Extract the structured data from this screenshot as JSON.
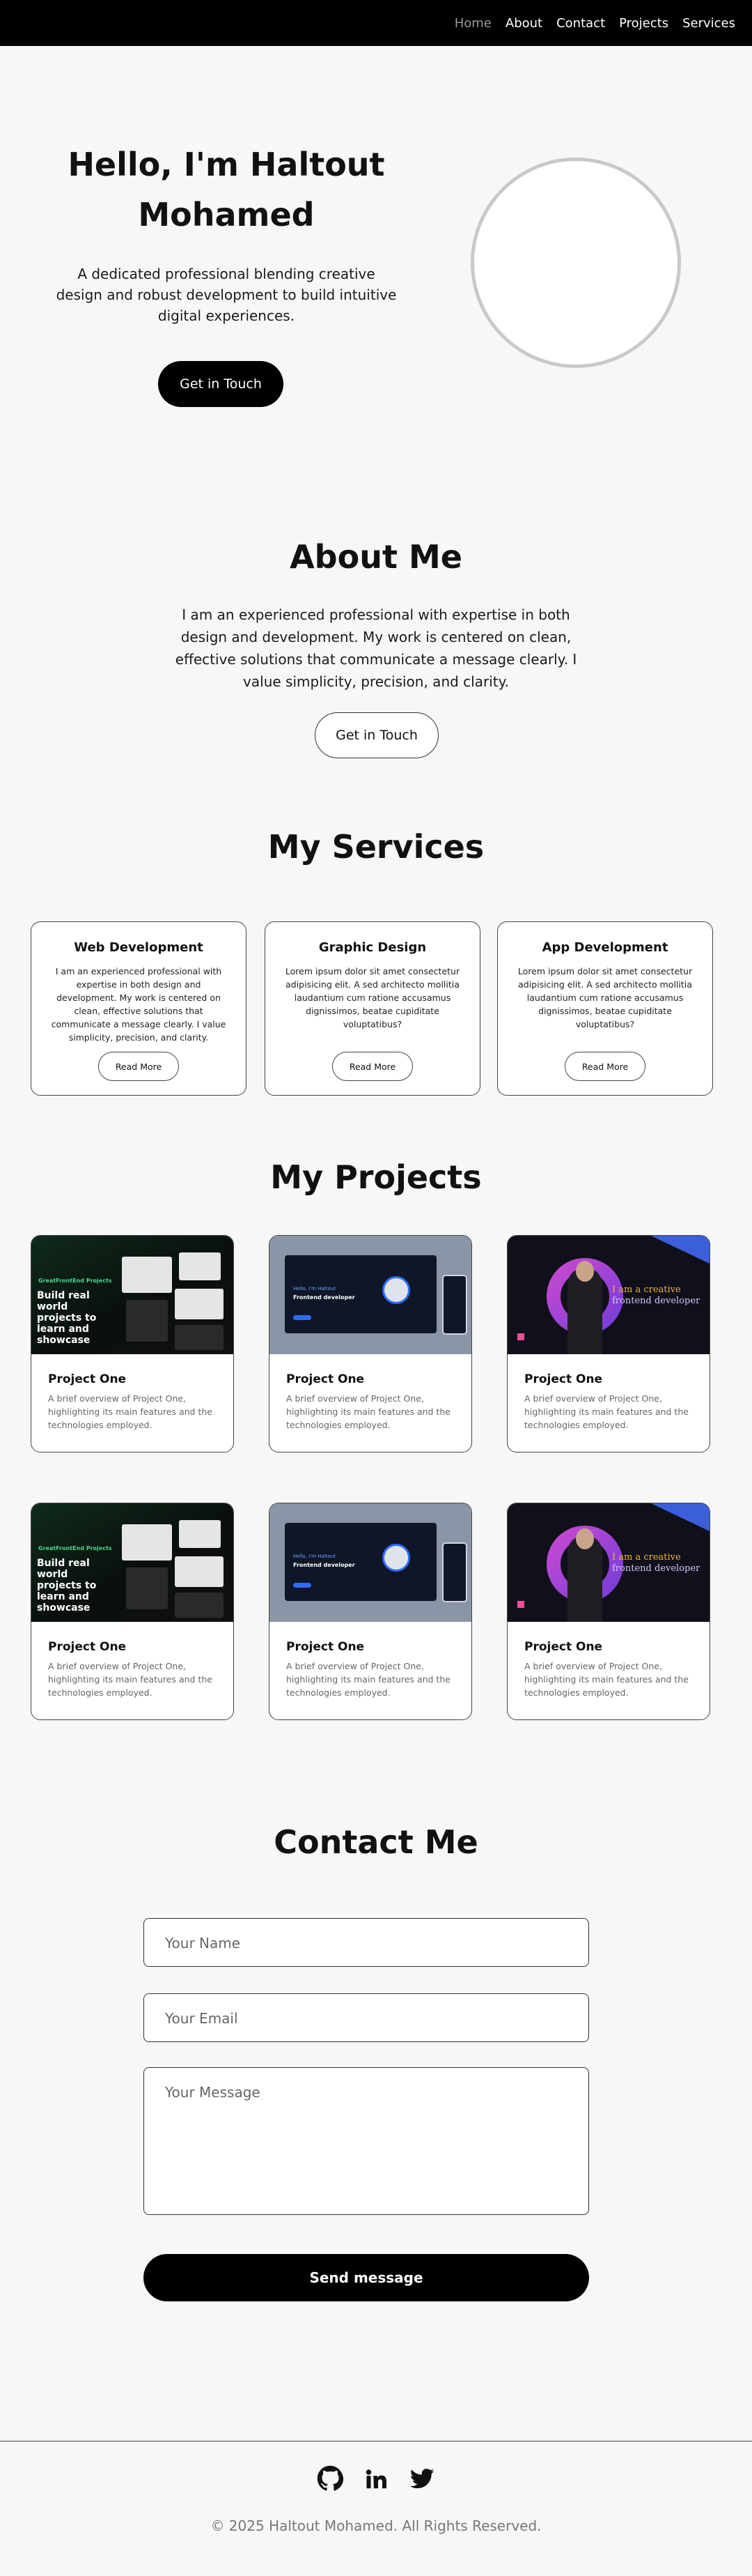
{
  "nav": {
    "items": [
      "Home",
      "About",
      "Contact",
      "Projects",
      "Services"
    ]
  },
  "hero": {
    "title": "Hello, I'm Haltout Mohamed",
    "description": "A dedicated professional blending creative design and robust development to build intuitive digital experiences.",
    "cta_label": "Get in Touch"
  },
  "about": {
    "title": "About Me",
    "text": "I am an experienced professional with expertise in both design and development. My work is centered on clean, effective solutions that communicate a message clearly. I value simplicity, precision, and clarity.",
    "cta_label": "Get in Touch"
  },
  "services": {
    "title": "My Services",
    "items": [
      {
        "title": "Web Development",
        "text": "I am an experienced professional with expertise in both design and development. My work is centered on clean, effective solutions that communicate a message clearly. I value simplicity, precision, and clarity.",
        "button": "Read More"
      },
      {
        "title": "Graphic Design",
        "text": "Lorem ipsum dolor sit amet consectetur adipisicing elit. A sed architecto mollitia laudantium cum ratione accusamus dignissimos, beatae cupiditate voluptatibus?",
        "button": "Read More"
      },
      {
        "title": "App Development",
        "text": "Lorem ipsum dolor sit amet consectetur adipisicing elit. A sed architecto mollitia laudantium cum ratione accusamus dignissimos, beatae cupiditate voluptatibus?",
        "button": "Read More"
      }
    ]
  },
  "projects": {
    "title": "My Projects",
    "items": [
      {
        "title": "Project One",
        "text": "A brief overview of Project One, highlighting its main features and the technologies employed.",
        "thumb_logo": "GreatFrontEnd Projects",
        "thumb_headline": "Build real world projects to learn and showcase"
      },
      {
        "title": "Project One",
        "text": "A brief overview of Project One, highlighting its main features and the technologies employed.",
        "thumb_line1": "Hello, I'm Haltout",
        "thumb_line2": "Frontend developer"
      },
      {
        "title": "Project One",
        "text": "A brief overview of Project One, highlighting its main features and the technologies employed.",
        "thumb_line1": "I am a creative",
        "thumb_line2": "frontend developer"
      },
      {
        "title": "Project One",
        "text": "A brief overview of Project One, highlighting its main features and the technologies employed.",
        "thumb_logo": "GreatFrontEnd Projects",
        "thumb_headline": "Build real world projects to learn and showcase"
      },
      {
        "title": "Project One",
        "text": "A brief overview of Project One, highlighting its main features and the technologies employed.",
        "thumb_line1": "Hello, I'm Haltout",
        "thumb_line2": "Frontend developer"
      },
      {
        "title": "Project One",
        "text": "A brief overview of Project One, highlighting its main features and the technologies employed.",
        "thumb_line1": "I am a creative",
        "thumb_line2": "frontend developer"
      }
    ]
  },
  "contact": {
    "title": "Contact Me",
    "name_placeholder": "Your Name",
    "email_placeholder": "Your Email",
    "message_placeholder": "Your Message",
    "send_label": "Send message"
  },
  "footer": {
    "social_icons": [
      "github-icon",
      "linkedin-icon",
      "twitter-icon"
    ],
    "copyright": "© 2025 Haltout Mohamed. All Rights Reserved."
  }
}
